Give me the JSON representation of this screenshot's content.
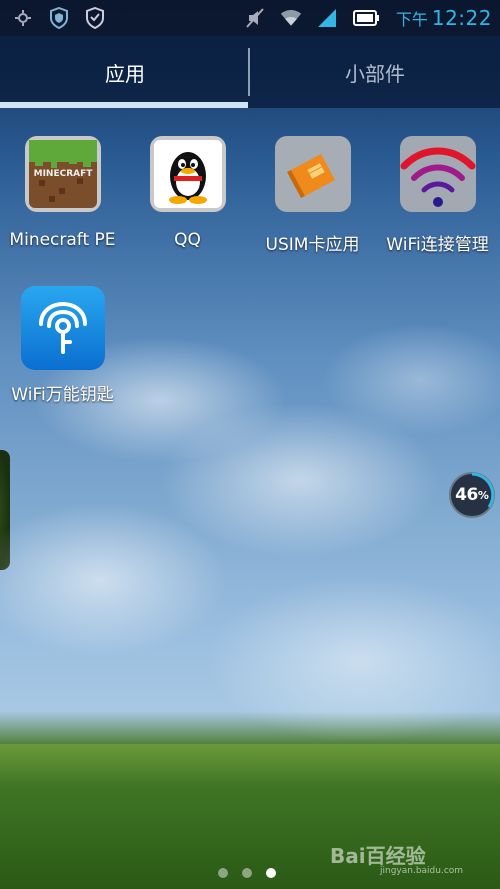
{
  "status_bar": {
    "icons_left": [
      "settings-icon",
      "shield-icon",
      "shield-check-icon"
    ],
    "icons_right": [
      "mute-icon",
      "wifi-icon",
      "signal-icon",
      "battery-icon"
    ],
    "ampm": "下午",
    "time": "12:22"
  },
  "tabs": [
    {
      "label": "应用",
      "active": true
    },
    {
      "label": "小部件",
      "active": false
    }
  ],
  "apps": [
    {
      "label": "Minecraft PE",
      "icon": "minecraft-icon"
    },
    {
      "label": "QQ",
      "icon": "qq-penguin-icon"
    },
    {
      "label": "USIM卡应用",
      "icon": "sim-card-icon"
    },
    {
      "label": "WiFi连接管理",
      "icon": "wifi-manager-icon"
    },
    {
      "label": "WiFi万能钥匙",
      "icon": "wifi-key-icon"
    }
  ],
  "floating_widget": {
    "value": "46",
    "unit": "%"
  },
  "page_indicator": {
    "total": 3,
    "current": 3
  },
  "watermark": {
    "text": "Bai百经验",
    "sub": "jingyan.baidu.com"
  }
}
